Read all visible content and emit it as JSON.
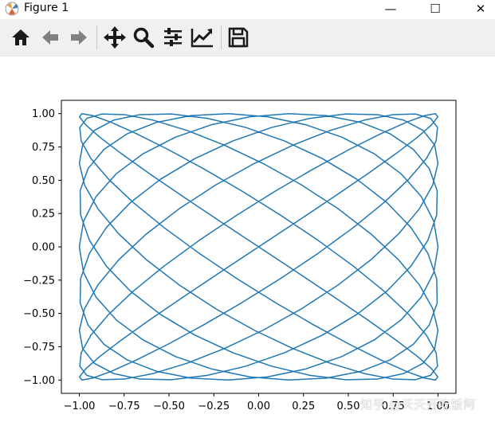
{
  "window": {
    "title": "Figure 1",
    "minimize_glyph": "—",
    "maximize_glyph": "☐",
    "close_glyph": "✕"
  },
  "toolbar": {
    "buttons": [
      {
        "name": "home-button",
        "icon": "home-icon"
      },
      {
        "name": "back-button",
        "icon": "arrow-left-icon"
      },
      {
        "name": "forward-button",
        "icon": "arrow-right-icon"
      },
      {
        "name": "pan-button",
        "icon": "move-icon"
      },
      {
        "name": "zoom-button",
        "icon": "magnifier-icon"
      },
      {
        "name": "configure-subplots-button",
        "icon": "sliders-icon"
      },
      {
        "name": "edit-axis-button",
        "icon": "line-chart-icon"
      },
      {
        "name": "save-button",
        "icon": "floppy-disk-icon"
      }
    ]
  },
  "chart_data": {
    "type": "line",
    "title": "",
    "xlabel": "",
    "ylabel": "",
    "xlim": [
      -1.1,
      1.1
    ],
    "ylim": [
      -1.1,
      1.1
    ],
    "x_ticks": [
      "−1.00",
      "−0.75",
      "−0.50",
      "−0.25",
      "0.00",
      "0.25",
      "0.50",
      "0.75",
      "1.00"
    ],
    "y_ticks": [
      "1.00",
      "0.75",
      "0.50",
      "0.25",
      "0.00",
      "−0.25",
      "−0.50",
      "−0.75",
      "−1.00"
    ],
    "series": [
      {
        "color": "#1f77b4",
        "x_function": "sin(a*t + delta)",
        "y_function": "sin(b*t)",
        "a": 9,
        "b": 8,
        "delta": 1.5707963,
        "t_range": [
          0,
          6.2831853
        ],
        "samples": 260
      }
    ],
    "grid": false,
    "legend": "none"
  },
  "watermark": "知乎 @天天开吃饭阿"
}
